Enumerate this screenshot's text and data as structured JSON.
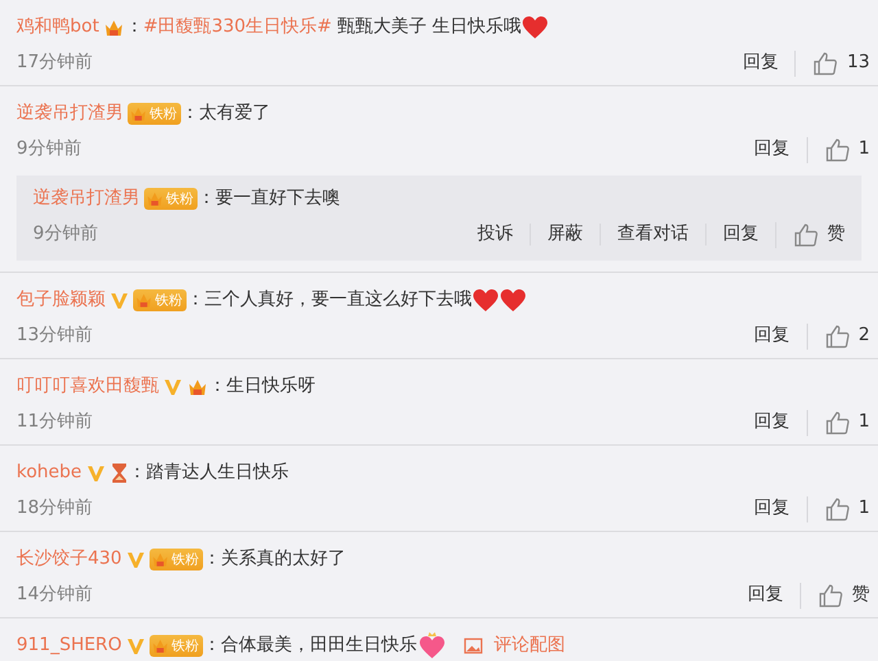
{
  "comments": [
    {
      "user": "鸡和鸭bot",
      "badges": [
        {
          "kind": "crown"
        }
      ],
      "text": [
        {
          "kind": "plain",
          "text": "："
        },
        {
          "kind": "hashtag",
          "text": "#田馥甄330生日快乐#"
        },
        {
          "kind": "plain",
          "text": " 甄甄大美子 生日快乐哦"
        }
      ],
      "emojis": [
        {
          "kind": "heart"
        }
      ],
      "time": "17分钟前",
      "actions": [
        {
          "kind": "reply",
          "label": "回复"
        },
        {
          "kind": "like",
          "label": "13"
        }
      ]
    },
    {
      "user": "逆袭吊打渣男",
      "badges": [
        {
          "kind": "fan",
          "label": "铁粉"
        }
      ],
      "text": [
        {
          "kind": "plain",
          "text": "：太有爱了"
        }
      ],
      "time": "9分钟前",
      "actions": [
        {
          "kind": "reply",
          "label": "回复"
        },
        {
          "kind": "like",
          "label": "1"
        }
      ],
      "replies": [
        {
          "user": "逆袭吊打渣男",
          "badges": [
            {
              "kind": "fan",
              "label": "铁粉"
            }
          ],
          "text": [
            {
              "kind": "plain",
              "text": "：要一直好下去噢"
            }
          ],
          "time": "9分钟前",
          "actions": [
            {
              "kind": "text",
              "label": "投诉"
            },
            {
              "kind": "text",
              "label": "屏蔽"
            },
            {
              "kind": "text",
              "label": "查看对话"
            },
            {
              "kind": "reply",
              "label": "回复"
            },
            {
              "kind": "like",
              "label": "赞"
            }
          ]
        }
      ]
    },
    {
      "user": "包子脸颖颖",
      "badges": [
        {
          "kind": "verified"
        },
        {
          "kind": "fan",
          "label": "铁粉"
        }
      ],
      "text": [
        {
          "kind": "plain",
          "text": "：三个人真好，要一直这么好下去哦"
        }
      ],
      "emojis": [
        {
          "kind": "heart"
        },
        {
          "kind": "heart"
        }
      ],
      "time": "13分钟前",
      "actions": [
        {
          "kind": "reply",
          "label": "回复"
        },
        {
          "kind": "like",
          "label": "2"
        }
      ]
    },
    {
      "user": "叮叮叮喜欢田馥甄",
      "badges": [
        {
          "kind": "verified"
        },
        {
          "kind": "crown"
        }
      ],
      "text": [
        {
          "kind": "plain",
          "text": "：生日快乐呀"
        }
      ],
      "time": "11分钟前",
      "actions": [
        {
          "kind": "reply",
          "label": "回复"
        },
        {
          "kind": "like",
          "label": "1"
        }
      ]
    },
    {
      "user": "kohebe",
      "badges": [
        {
          "kind": "verified"
        },
        {
          "kind": "hourglass"
        }
      ],
      "text": [
        {
          "kind": "plain",
          "text": "：踏青达人生日快乐"
        }
      ],
      "time": "18分钟前",
      "actions": [
        {
          "kind": "reply",
          "label": "回复"
        },
        {
          "kind": "like",
          "label": "1"
        }
      ]
    },
    {
      "user": "长沙饺子430",
      "badges": [
        {
          "kind": "verified"
        },
        {
          "kind": "fan",
          "label": "铁粉"
        }
      ],
      "text": [
        {
          "kind": "plain",
          "text": "：关系真的太好了"
        }
      ],
      "time": "14分钟前",
      "actions": [
        {
          "kind": "reply",
          "label": "回复"
        },
        {
          "kind": "like",
          "label": "赞"
        }
      ]
    },
    {
      "user": "911_SHERO",
      "badges": [
        {
          "kind": "verified"
        },
        {
          "kind": "fan",
          "label": "铁粉"
        }
      ],
      "text": [
        {
          "kind": "plain",
          "text": "：合体最美，田田生日快乐"
        }
      ],
      "emojis": [
        {
          "kind": "pink-heart"
        }
      ],
      "attachment": {
        "label": "评论配图"
      }
    }
  ]
}
